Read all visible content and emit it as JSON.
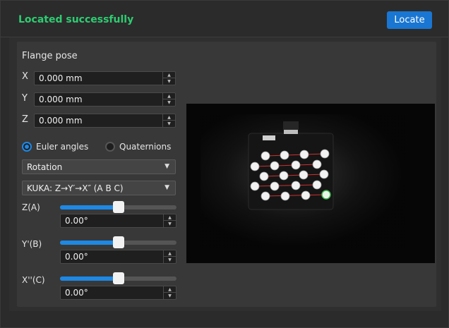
{
  "header": {
    "status": "Located successfully",
    "locate_label": "Locate",
    "status_color": "#2ecc71",
    "accent_color": "#1976d2"
  },
  "pose": {
    "title": "Flange pose",
    "x": {
      "label": "X",
      "value": "0.000 mm"
    },
    "y": {
      "label": "Y",
      "value": "0.000 mm"
    },
    "z": {
      "label": "Z",
      "value": "0.000 mm"
    },
    "euler_label": "Euler angles",
    "quaternion_label": "Quaternions",
    "selected_representation": "Euler angles",
    "mode_select": "Rotation",
    "convention_select": "KUKA: Z→Y′→X″ (A B C)",
    "rotations": [
      {
        "label": "Z(A)",
        "value": "0.00°",
        "level": 0.5
      },
      {
        "label": "Y'(B)",
        "value": "0.00°",
        "level": 0.5
      },
      {
        "label": "X''(C)",
        "value": "0.00°",
        "level": 0.5
      }
    ]
  },
  "icons": {
    "up_arrow": "▲",
    "down_arrow": "▼",
    "caret": "▼"
  }
}
